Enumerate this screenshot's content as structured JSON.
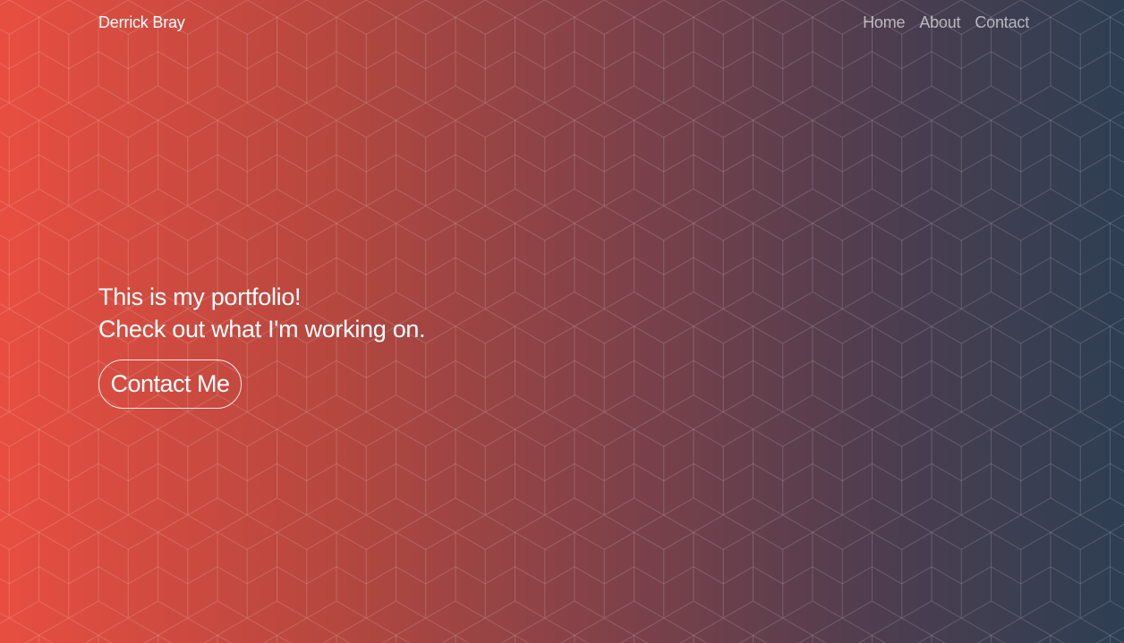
{
  "header": {
    "brand": "Derrick Bray",
    "nav": [
      {
        "label": "Home"
      },
      {
        "label": "About"
      },
      {
        "label": "Contact"
      }
    ]
  },
  "hero": {
    "line1": "This is my portfolio!",
    "line2": "Check out what I'm working on.",
    "cta_label": "Contact Me"
  },
  "colors": {
    "gradient_start": "#e84e40",
    "gradient_end": "#2e3e53",
    "pattern": "cube-grid"
  }
}
